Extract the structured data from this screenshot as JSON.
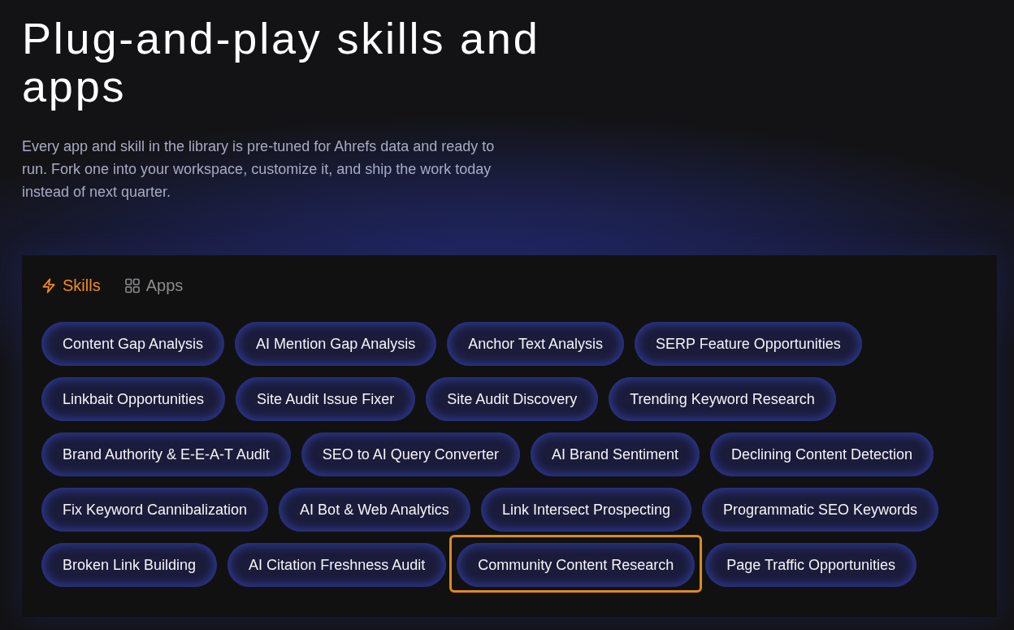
{
  "heading": "Plug-and-play skills and apps",
  "description": "Every app and skill in the library is pre-tuned for Ahrefs data and ready to run. Fork one into your workspace, customize it, and ship the work today instead of next quarter.",
  "library": {
    "tabs": [
      {
        "label": "Skills",
        "kind": "skills",
        "selected": true
      },
      {
        "label": "Apps",
        "kind": "apps",
        "selected": false
      }
    ],
    "chips": [
      {
        "label": "Content Gap Analysis",
        "focused": false
      },
      {
        "label": "AI Mention Gap Analysis",
        "focused": false
      },
      {
        "label": "Anchor Text Analysis",
        "focused": false
      },
      {
        "label": "SERP Feature Opportunities",
        "focused": false
      },
      {
        "label": "Linkbait Opportunities",
        "focused": false
      },
      {
        "label": "Site Audit Issue Fixer",
        "focused": false
      },
      {
        "label": "Site Audit Discovery",
        "focused": false
      },
      {
        "label": "Trending Keyword Research",
        "focused": false
      },
      {
        "label": "Brand Authority & E-E-A-T Audit",
        "focused": false
      },
      {
        "label": "SEO to AI Query Converter",
        "focused": false
      },
      {
        "label": "AI Brand Sentiment",
        "focused": false
      },
      {
        "label": "Declining Content Detection",
        "focused": false
      },
      {
        "label": "Fix Keyword Cannibalization",
        "focused": false
      },
      {
        "label": "AI Bot & Web Analytics",
        "focused": false
      },
      {
        "label": "Link Intersect Prospecting",
        "focused": false
      },
      {
        "label": "Programmatic SEO Keywords",
        "focused": false
      },
      {
        "label": "Broken Link Building",
        "focused": false
      },
      {
        "label": "AI Citation Freshness Audit",
        "focused": false
      },
      {
        "label": "Community Content Research",
        "focused": true
      },
      {
        "label": "Page Traffic Opportunities",
        "focused": false
      }
    ]
  }
}
